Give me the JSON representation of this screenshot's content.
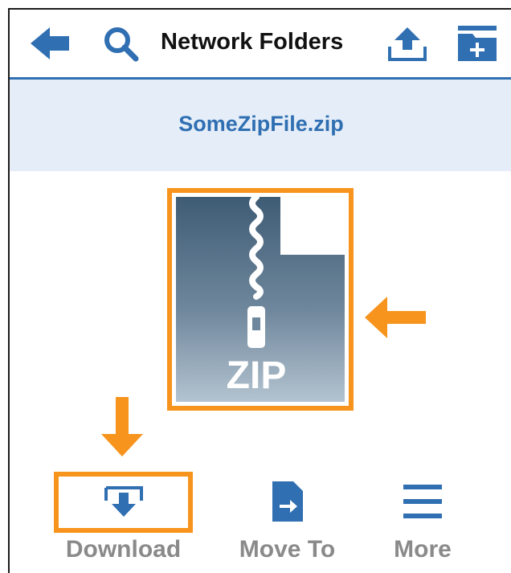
{
  "toolbar": {
    "title": "Network Folders",
    "icons": [
      "back-arrow-icon",
      "search-icon",
      "upload-icon",
      "new-folder-icon"
    ]
  },
  "file": {
    "name": "SomeZipFile.zip",
    "thumbnail_label": "ZIP"
  },
  "actions": {
    "download": "Download",
    "move_to": "Move To",
    "more": "More"
  },
  "colors": {
    "brand_blue": "#2f6fb2",
    "highlight_orange": "#f7941d",
    "banner_bg": "#e5eef8",
    "label_gray": "#8a8a8a"
  }
}
